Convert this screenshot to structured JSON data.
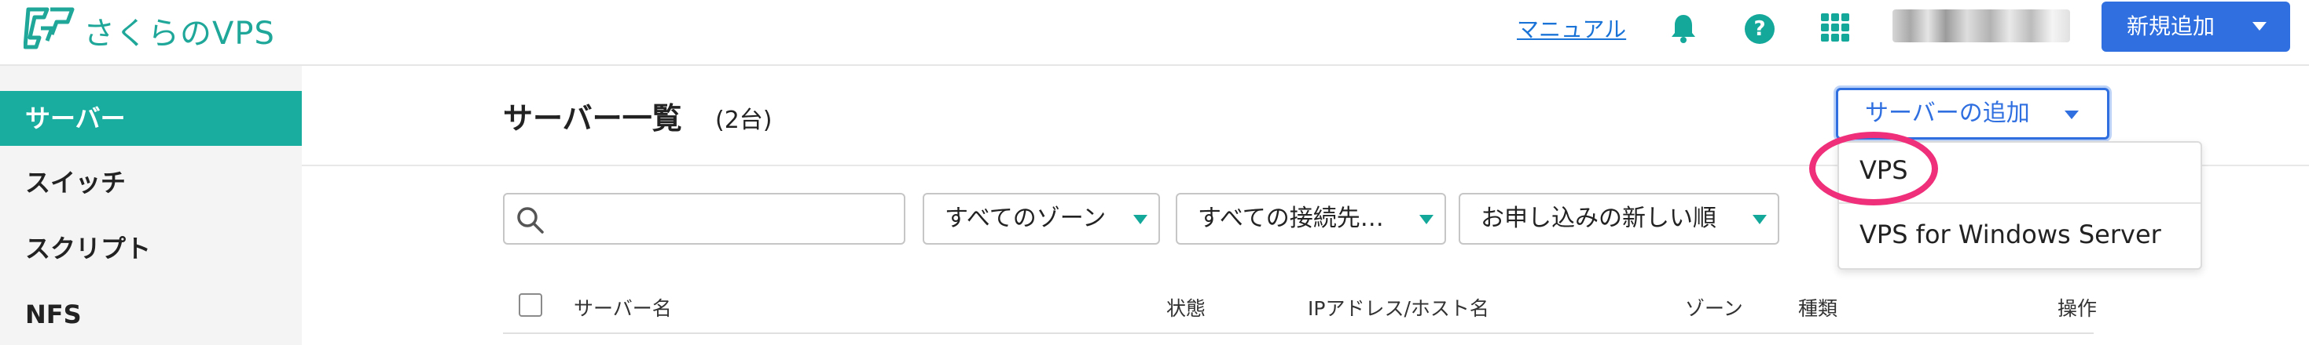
{
  "header": {
    "logo_text": "さくらのVPS",
    "manual_link": "マニュアル",
    "help_icon_text": "?",
    "new_add_button": "新規追加",
    "brand_color": "#1fa79a",
    "primary_color": "#2f6fe0"
  },
  "sidebar": {
    "items": [
      {
        "label": "サーバー",
        "active": true
      },
      {
        "label": "スイッチ",
        "active": false
      },
      {
        "label": "スクリプト",
        "active": false
      },
      {
        "label": "NFS",
        "active": false
      }
    ]
  },
  "main": {
    "title": "サーバー一覧",
    "count": "(2台)",
    "add_server_button": "サーバーの追加",
    "add_menu": {
      "items": [
        "VPS",
        "VPS for Windows Server"
      ],
      "highlighted": "VPS"
    },
    "search": {
      "value": "",
      "placeholder": ""
    },
    "filters": {
      "zone": "すべてのゾーン",
      "connection": "すべての接続先…",
      "sort": "お申し込みの新しい順"
    },
    "table": {
      "columns": [
        "サーバー名",
        "状態",
        "IPアドレス/ホスト名",
        "ゾーン",
        "種類",
        "操作"
      ]
    }
  },
  "icons": [
    "logo-icon",
    "bell-icon",
    "help-icon",
    "apps-icon",
    "search-icon",
    "chevron-down-icon",
    "checkbox-icon"
  ]
}
